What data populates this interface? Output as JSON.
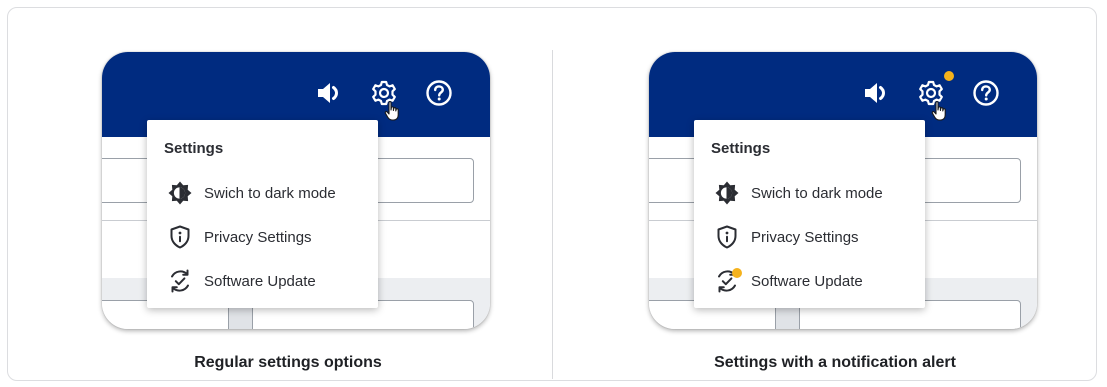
{
  "panels": [
    {
      "caption": "Regular settings options",
      "menu": {
        "title": "Settings",
        "items": [
          {
            "label": "Swich to dark mode",
            "icon": "dark-mode-icon"
          },
          {
            "label": "Privacy Settings",
            "icon": "shield-info-icon"
          },
          {
            "label": "Software Update",
            "icon": "refresh-check-icon"
          }
        ]
      },
      "topbar_icons": [
        "volume-icon",
        "gear-icon",
        "help-icon"
      ],
      "notification": false
    },
    {
      "caption": "Settings with a notification alert",
      "menu": {
        "title": "Settings",
        "items": [
          {
            "label": "Swich to dark mode",
            "icon": "dark-mode-icon"
          },
          {
            "label": "Privacy Settings",
            "icon": "shield-info-icon"
          },
          {
            "label": "Software Update",
            "icon": "refresh-check-icon"
          }
        ]
      },
      "topbar_icons": [
        "volume-icon",
        "gear-icon",
        "help-icon"
      ],
      "notification": true
    }
  ],
  "colors": {
    "topbar": "#002b80",
    "notification_dot": "#f5b21c",
    "text": "#2b2d33"
  }
}
